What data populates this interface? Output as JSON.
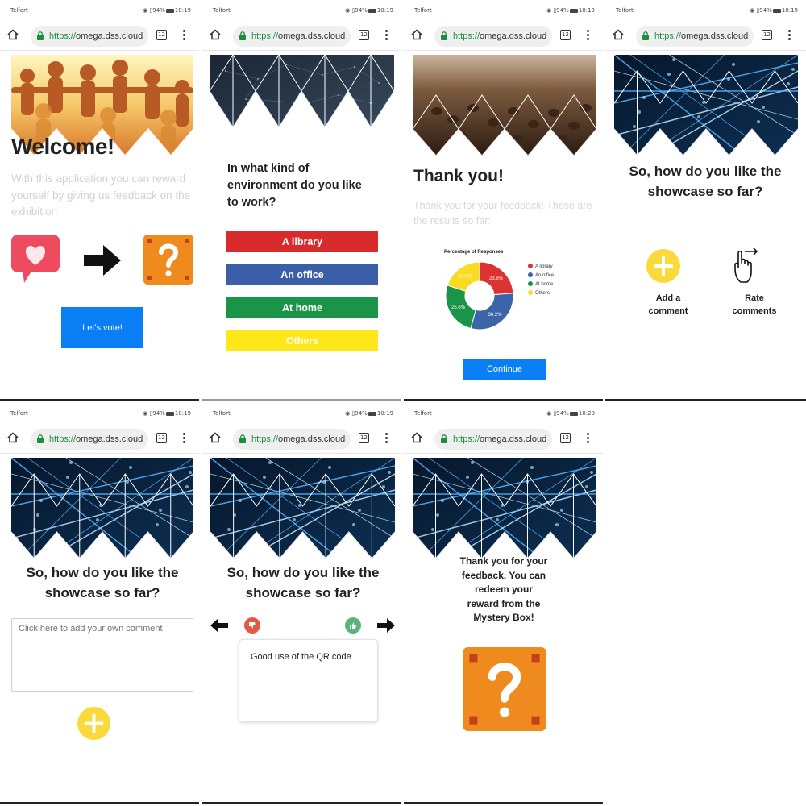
{
  "colors": {
    "accent_blue": "#0a7ff5",
    "red": "#d92b2b",
    "blue": "#3a5fa8",
    "green": "#1a9548",
    "yellow": "#ffe81a",
    "plus_yellow": "#fcd93a",
    "mystery_orange": "#ef8a1e",
    "heart_red": "#ee4b5f"
  },
  "screens": [
    {
      "status": {
        "carrier": "Telfort",
        "battery": "94%",
        "time": "10:19"
      },
      "browser": {
        "scheme": "https://",
        "host": "omega.dss.cloud",
        "tabs": "12"
      },
      "title": "Welcome!",
      "text": "With this application you can reward yourself by giving us feedback on the exhibition",
      "button": "Let's vote!",
      "icons": [
        "heart-chat-icon",
        "arrow-right-icon",
        "mystery-box-icon"
      ]
    },
    {
      "status": {
        "carrier": "Telfort",
        "battery": "94%",
        "time": "10:19"
      },
      "browser": {
        "scheme": "https://",
        "host": "omega.dss.cloud",
        "tabs": "12"
      },
      "question": "In what kind of environment do you like to work?",
      "choices": [
        "A library",
        "An office",
        "At home",
        "Others"
      ]
    },
    {
      "status": {
        "carrier": "Telfort",
        "battery": "94%",
        "time": "10:19"
      },
      "browser": {
        "scheme": "https://",
        "host": "omega.dss.cloud",
        "tabs": "12"
      },
      "title": "Thank you!",
      "text": "Thank you for your feedback! These are the results so far:",
      "button": "Continue"
    },
    {
      "status": {
        "carrier": "Telfort",
        "battery": "94%",
        "time": "10:19"
      },
      "browser": {
        "scheme": "https://",
        "host": "omega.dss.cloud",
        "tabs": "12"
      },
      "question": "So, how do you like the showcase so far?",
      "option_add": "Add a comment",
      "option_rate": "Rate comments"
    },
    {
      "status": {
        "carrier": "Telfort",
        "battery": "94%",
        "time": "10:19"
      },
      "browser": {
        "scheme": "https://",
        "host": "omega.dss.cloud",
        "tabs": "12"
      },
      "question": "So, how do you like the showcase so far?",
      "placeholder": "Click here to add your own comment"
    },
    {
      "status": {
        "carrier": "Telfort",
        "battery": "94%",
        "time": "10:19"
      },
      "browser": {
        "scheme": "https://",
        "host": "omega.dss.cloud",
        "tabs": "12"
      },
      "question": "So, how do you like the showcase so far?",
      "comment": "Good use of the QR code"
    },
    {
      "status": {
        "carrier": "Telfort",
        "battery": "94%",
        "time": "10:20"
      },
      "browser": {
        "scheme": "https://",
        "host": "omega.dss.cloud",
        "tabs": "12"
      },
      "text": "Thank you for your feedback. You can redeem your reward from the Mystery Box!"
    }
  ],
  "chart_data": {
    "type": "pie",
    "donut": true,
    "title": "Percentage of Responses",
    "categories": [
      "A library",
      "An office",
      "At home",
      "Others"
    ],
    "values": [
      23.6,
      30.2,
      25.6,
      19.8
    ],
    "colors": [
      "#dc3232",
      "#3c64a8",
      "#1a9548",
      "#fbdb22"
    ],
    "data_labels": [
      "23.6%",
      "30.2%",
      "25.6%",
      "19.8%"
    ],
    "legend": "right"
  }
}
